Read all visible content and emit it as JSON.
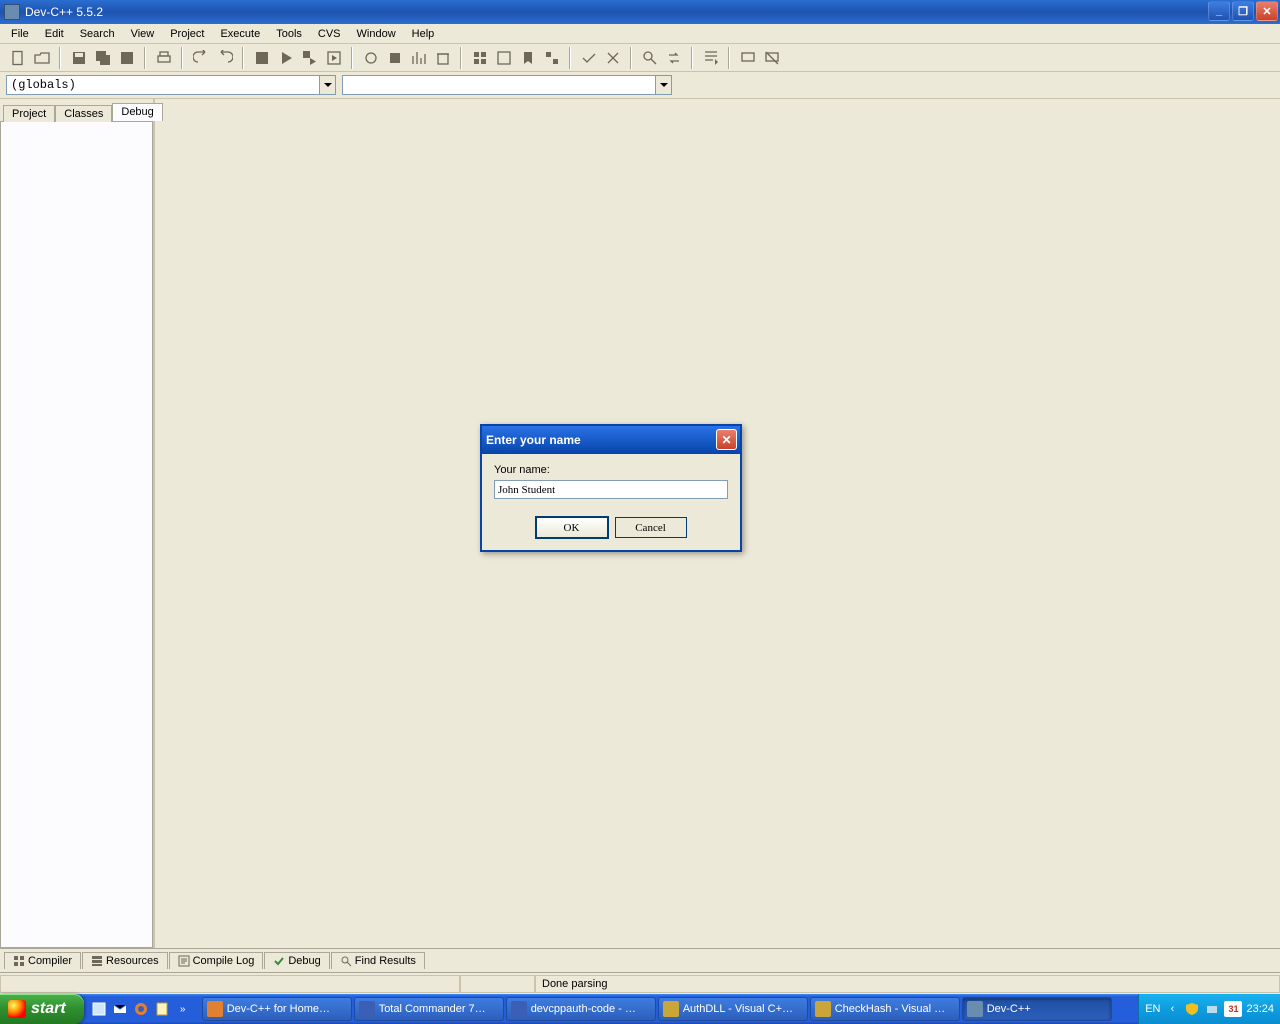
{
  "window": {
    "title": "Dev-C++ 5.5.2"
  },
  "menus": [
    "File",
    "Edit",
    "Search",
    "View",
    "Project",
    "Execute",
    "Tools",
    "CVS",
    "Window",
    "Help"
  ],
  "combo1": "(globals)",
  "combo2": "",
  "side_tabs": {
    "t0": "Project",
    "t1": "Classes",
    "t2": "Debug"
  },
  "bottom_tabs": {
    "t0": "Compiler",
    "t1": "Resources",
    "t2": "Compile Log",
    "t3": "Debug",
    "t4": "Find Results"
  },
  "status": {
    "msg": "Done parsing"
  },
  "dialog": {
    "title": "Enter your name",
    "label": "Your name:",
    "value": "John Student",
    "ok": "OK",
    "cancel": "Cancel"
  },
  "taskbar": {
    "start": "start",
    "items": [
      {
        "label": "Dev-C++ for Home…",
        "color": "#e08030"
      },
      {
        "label": "Total Commander 7…",
        "color": "#3a5fb5"
      },
      {
        "label": "devcppauth-code - …",
        "color": "#3a5fb5"
      },
      {
        "label": "AuthDLL - Visual C+…",
        "color": "#caa63a"
      },
      {
        "label": "CheckHash - Visual …",
        "color": "#caa63a"
      },
      {
        "label": "Dev-C++",
        "color": "#6a8caf"
      }
    ],
    "lang": "EN",
    "clock": "23:24",
    "date": "31"
  }
}
